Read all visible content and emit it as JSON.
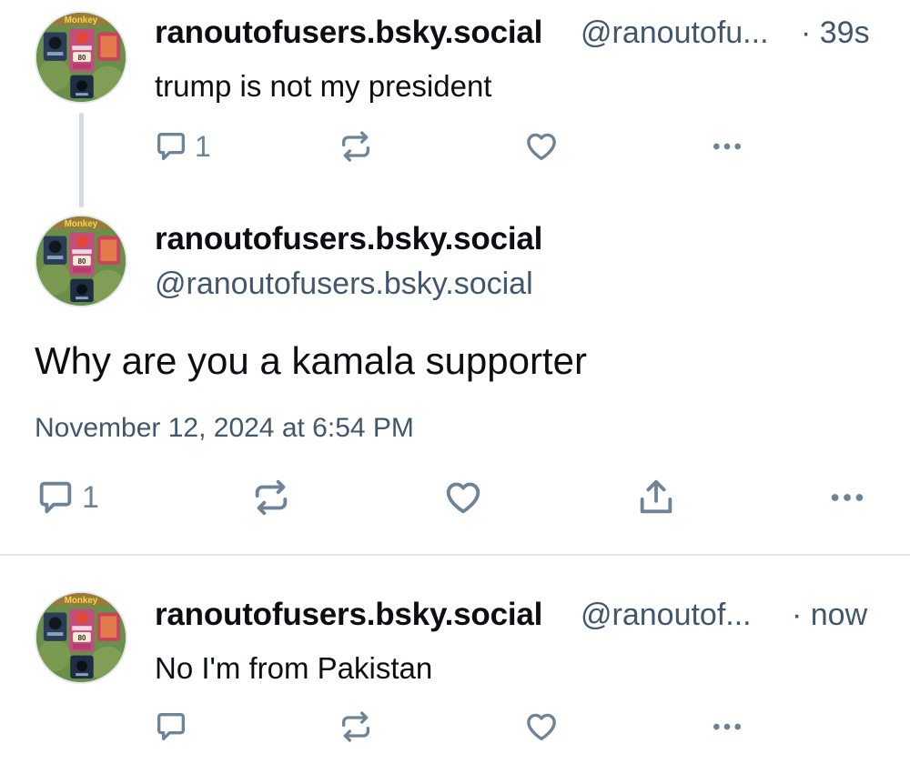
{
  "colors": {
    "text_primary": "#0b0f14",
    "text_secondary": "#42576c",
    "icon": "#6f8396",
    "divider": "#e3e7ec"
  },
  "avatar": {
    "top_label": "Monkey",
    "badge_value": "80"
  },
  "posts": [
    {
      "display_name": "ranoutofusers.bsky.social",
      "handle": "@ranoutofu...",
      "time": "· 39s",
      "text": "trump is not my president",
      "reply_count": "1",
      "actions": [
        "reply-icon",
        "repost-icon",
        "like-icon",
        "more-icon"
      ]
    },
    {
      "display_name": "ranoutofusers.bsky.social",
      "handle": "@ranoutofusers.bsky.social",
      "text": "Why are you a kamala supporter",
      "timestamp": "November 12, 2024 at 6:54 PM",
      "reply_count": "1",
      "actions": [
        "reply-icon",
        "repost-icon",
        "like-icon",
        "share-icon",
        "more-icon"
      ]
    },
    {
      "display_name": "ranoutofusers.bsky.social",
      "handle": "@ranoutof...",
      "time": "· now",
      "text": "No I'm from Pakistan",
      "actions": [
        "reply-icon",
        "repost-icon",
        "like-icon",
        "more-icon"
      ]
    }
  ]
}
